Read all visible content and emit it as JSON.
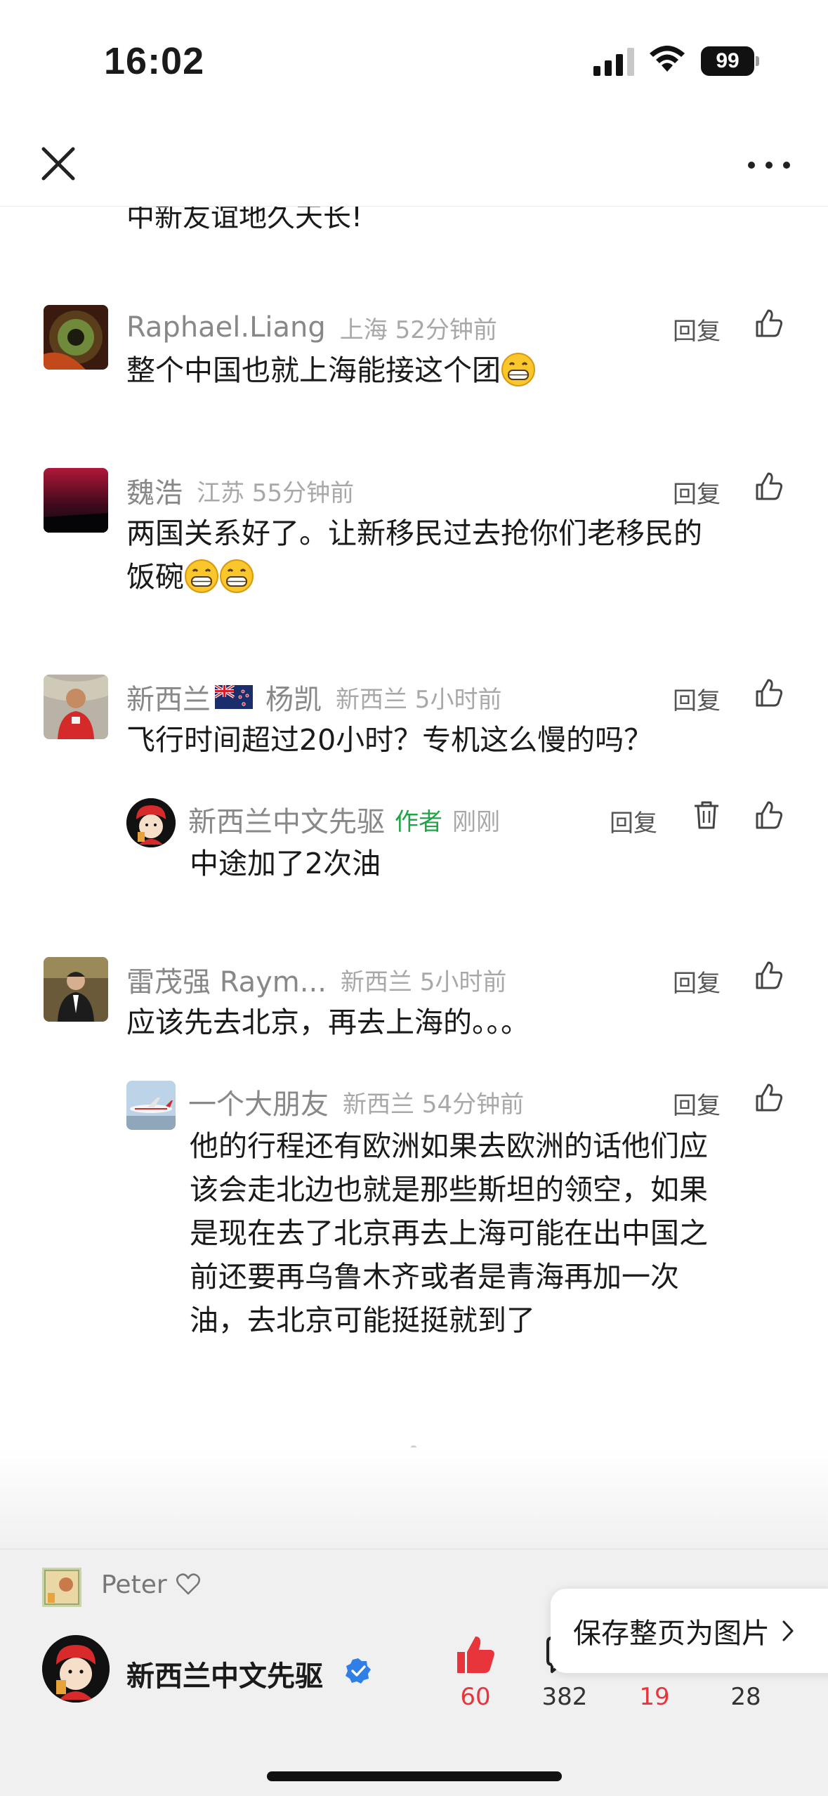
{
  "status": {
    "time": "16:02",
    "battery": "99"
  },
  "post_tail": "中新友谊地久天长!",
  "comments": [
    {
      "name": "Raphael.Liang",
      "meta": "上海 52分钟前",
      "reply": "回复",
      "text": "整个中国也就上海能接这个团"
    },
    {
      "name": "魏浩",
      "meta": "江苏 55分钟前",
      "reply": "回复",
      "text_line1": "两国关系好了。让新移民过去抢你们老移民的",
      "text_line2": "饭碗"
    },
    {
      "name_part1": "新西兰",
      "name_part2": "杨凯",
      "meta": "新西兰 5小时前",
      "reply": "回复",
      "text": "飞行时间超过20小时？专机这么慢的吗？",
      "sub_reply": {
        "name": "新西兰中文先驱",
        "author_tag": "作者",
        "meta": "刚刚",
        "reply": "回复",
        "text": "中途加了2次油"
      }
    },
    {
      "name": "雷茂强 Raym...",
      "meta": "新西兰 5小时前",
      "reply": "回复",
      "text": "应该先去北京，再去上海的。。。",
      "sub_reply": {
        "name": "一个大朋友",
        "meta": "新西兰 54分钟前",
        "reply": "回复",
        "lines": [
          "他的行程还有欧洲如果去欧洲的话他们应",
          "该会走北边也就是那些斯坦的领空，如果",
          "是现在去了北京再去上海可能在出中国之",
          "前还要再乌鲁木齐或者是青海再加一次",
          "油，去北京可能挺挺就到了"
        ]
      }
    }
  ],
  "bottom": {
    "liker_name": "Peter",
    "author_name": "新西兰中文先驱",
    "save_popup": "保存整页为图片",
    "stats": {
      "likes": "60",
      "comments": "382",
      "favorites": "19",
      "shares": "28"
    },
    "colors": {
      "like_red": "#e8353b",
      "author_green": "#21a448",
      "verified_blue": "#2f7fe6"
    }
  }
}
